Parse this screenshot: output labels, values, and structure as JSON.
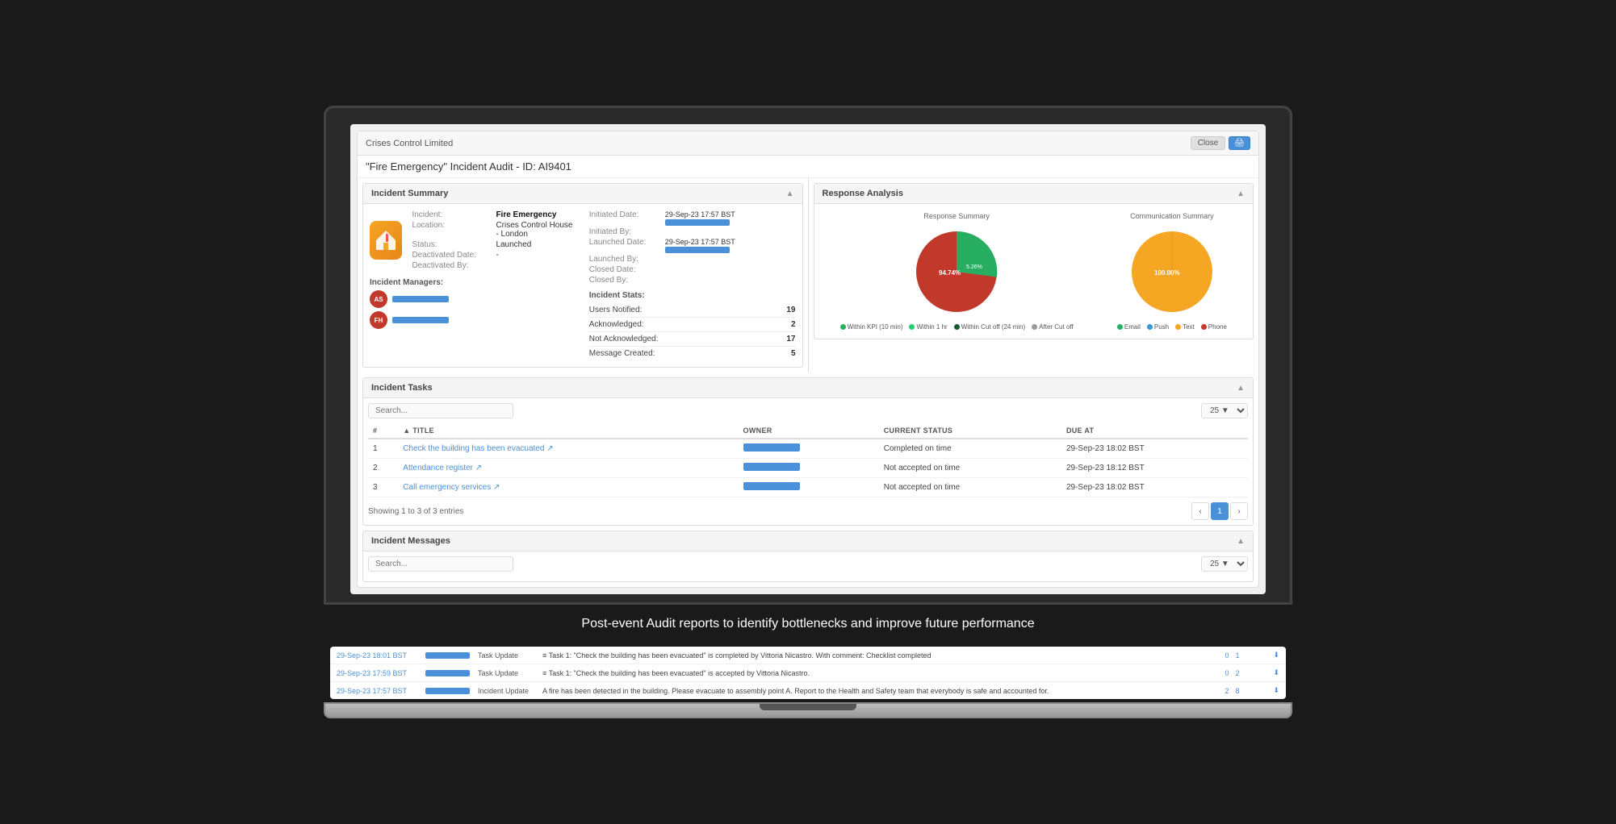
{
  "app": {
    "company": "Crises Control Limited",
    "incident_title": "\"Fire Emergency\" Incident Audit - ID: AI9401",
    "close_label": "Close",
    "print_icon": "🖨"
  },
  "incident_summary": {
    "section_title": "Incident Summary",
    "icon": "🏠",
    "fields": {
      "incident_label": "Incident:",
      "incident_value": "Fire Emergency",
      "location_label": "Location:",
      "location_value": "Crises Control House - London",
      "status_label": "Status:",
      "status_value": "Launched",
      "deactivated_date_label": "Deactivated Date:",
      "deactivated_date_value": "-",
      "deactivated_by_label": "Deactivated By:",
      "deactivated_by_value": "",
      "initiated_date_label": "Initiated Date:",
      "initiated_date_value": "29-Sep-23 17:57 BST",
      "initiated_by_label": "Initiated By:",
      "initiated_by_value": "",
      "launched_date_label": "Launched Date:",
      "launched_date_value": "29-Sep-23 17:57 BST",
      "launched_by_label": "Launched By:",
      "launched_by_value": "",
      "closed_date_label": "Closed Date:",
      "closed_date_value": "",
      "closed_by_label": "Closed By:",
      "closed_by_value": ""
    },
    "managers": {
      "title": "Incident Managers:",
      "items": [
        {
          "initials": "AS"
        },
        {
          "initials": "FH"
        }
      ]
    },
    "stats": {
      "title": "Incident Stats:",
      "users_notified_label": "Users Notified:",
      "users_notified_value": "19",
      "acknowledged_label": "Acknowledged:",
      "acknowledged_value": "2",
      "not_acknowledged_label": "Not Acknowledged:",
      "not_acknowledged_value": "17",
      "message_created_label": "Message Created:",
      "message_created_value": "5"
    }
  },
  "response_analysis": {
    "section_title": "Response Analysis",
    "response_summary": {
      "title": "Response Summary",
      "slices": [
        {
          "label": "Within KPI (10 min)",
          "color": "#c0392b",
          "percent": 94.74,
          "display": "94.74%"
        },
        {
          "label": "Within Cut off (24 min)",
          "color": "#27ae60",
          "percent": 0.5,
          "display": ""
        },
        {
          "label": "Within 1 hr",
          "color": "#2ecc71",
          "percent": 0.5,
          "display": ""
        },
        {
          "label": "After Cut off",
          "color": "#1a7a3c",
          "percent": 5.26,
          "display": "5.26%"
        }
      ],
      "legend": [
        {
          "label": "Within KPI (10 min)",
          "color": "#27ae60"
        },
        {
          "label": "Within 1 hr",
          "color": "#2ecc71"
        },
        {
          "label": "Within Cut off (24 min)",
          "color": "#1a7a3c"
        },
        {
          "label": "After Cut off",
          "color": "#c0c0c0"
        }
      ]
    },
    "communication_summary": {
      "title": "Communication Summary",
      "slices": [
        {
          "label": "Text",
          "color": "#f5a623",
          "percent": 100,
          "display": "100.00%"
        }
      ],
      "legend": [
        {
          "label": "Email",
          "color": "#27ae60"
        },
        {
          "label": "Push",
          "color": "#3498db"
        },
        {
          "label": "Text",
          "color": "#f5a623"
        },
        {
          "label": "Phone",
          "color": "#c0392b"
        }
      ]
    }
  },
  "incident_tasks": {
    "section_title": "Incident Tasks",
    "search_placeholder": "Search...",
    "per_page": "25",
    "columns": [
      "#",
      "TITLE",
      "OWNER",
      "CURRENT STATUS",
      "DUE AT"
    ],
    "rows": [
      {
        "num": "1",
        "title": "Check the building has been evacuated",
        "status": "Completed on time",
        "due_at": "29-Sep-23 18:02 BST"
      },
      {
        "num": "2",
        "title": "Attendance register",
        "status": "Not accepted on time",
        "due_at": "29-Sep-23 18:12 BST"
      },
      {
        "num": "3",
        "title": "Call emergency services",
        "status": "Not accepted on time",
        "due_at": "29-Sep-23 18:02 BST"
      }
    ],
    "showing_text": "Showing 1 to 3 of 3 entries",
    "pagination": {
      "prev": "‹",
      "current": "1",
      "next": "›"
    }
  },
  "incident_messages": {
    "section_title": "Incident Messages",
    "search_placeholder": "Search...",
    "per_page": "25"
  },
  "caption": "Post-event Audit reports to identify bottlenecks and improve future performance",
  "message_rows": [
    {
      "date": "29-Sep-23 18:01 BST",
      "type": "Task Update",
      "content": "≡ Task 1: \"Check the building has been evacuated\" is completed by Vittoria Nicastro. With comment: Checklist completed",
      "num1": "0",
      "num2": "1"
    },
    {
      "date": "29-Sep-23 17:59 BST",
      "type": "Task Update",
      "content": "≡ Task 1: \"Check the building has been evacuated\" is accepted by Vittoria Nicastro.",
      "num1": "0",
      "num2": "2"
    },
    {
      "date": "29-Sep-23 17:57 BST",
      "type": "Incident Update",
      "content": "A fire has been detected in the building. Please evacuate to assembly point A. Report to the Health and Safety team that everybody is safe and accounted for.",
      "num1": "2",
      "num2": "8"
    }
  ]
}
